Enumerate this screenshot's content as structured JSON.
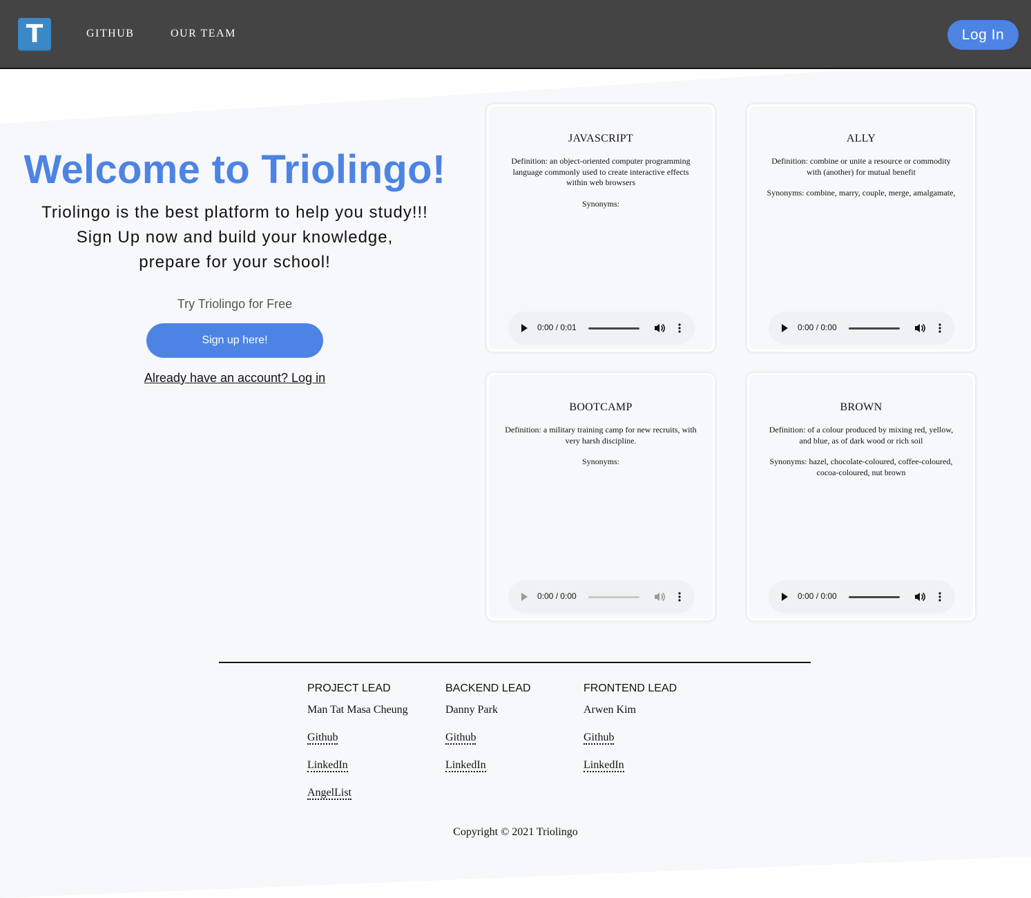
{
  "header": {
    "logo_letter": "T",
    "nav": {
      "github": "GITHUB",
      "team": "OUR TEAM"
    },
    "login_label": "Log In"
  },
  "hero": {
    "title": "Welcome to Triolingo!",
    "subtitle_lines": [
      "Triolingo is the best platform to help you study!!!",
      "Sign Up now and build your knowledge,",
      "prepare for your school!"
    ],
    "try_text": "Try Triolingo for Free",
    "signup_label": "Sign up here!",
    "login_link": "Already have an account? Log in"
  },
  "cards": [
    {
      "word": "JAVASCRIPT",
      "definition": "Definition: an object-oriented computer programming language commonly used to create interactive effects within web browsers",
      "synonyms": "Synonyms:",
      "audio_time": "0:00 / 0:01",
      "audio_enabled": true
    },
    {
      "word": "ALLY",
      "definition": "Definition: combine or unite a resource or commodity with (another) for mutual benefit",
      "synonyms": "Synonyms: combine, marry, couple, merge, amalgamate,",
      "audio_time": "0:00 / 0:00",
      "audio_enabled": true
    },
    {
      "word": "BOOTCAMP",
      "definition": "Definition: a military training camp for new recruits, with very harsh discipline.",
      "synonyms": "Synonyms:",
      "audio_time": "0:00 / 0:00",
      "audio_enabled": false
    },
    {
      "word": "BROWN",
      "definition": "Definition: of a colour produced by mixing red, yellow, and blue, as of dark wood or rich soil",
      "synonyms": "Synonyms: hazel, chocolate-coloured, coffee-coloured, cocoa-coloured, nut brown",
      "audio_time": "0:00 / 0:00",
      "audio_enabled": true
    }
  ],
  "team": [
    {
      "role": "PROJECT LEAD",
      "name": "Man Tat Masa Cheung",
      "links": [
        "Github",
        "LinkedIn",
        "AngelList"
      ]
    },
    {
      "role": "BACKEND LEAD",
      "name": "Danny Park",
      "links": [
        "Github",
        "LinkedIn"
      ]
    },
    {
      "role": "FRONTEND LEAD",
      "name": "Arwen Kim",
      "links": [
        "Github",
        "LinkedIn"
      ]
    }
  ],
  "footer": {
    "copyright": "Copyright © 2021 Triolingo"
  },
  "colors": {
    "accent": "#4d84e4",
    "header_bg": "#444444",
    "page_bg": "#f7f8fc",
    "logo_bg": "#3b88c7"
  }
}
